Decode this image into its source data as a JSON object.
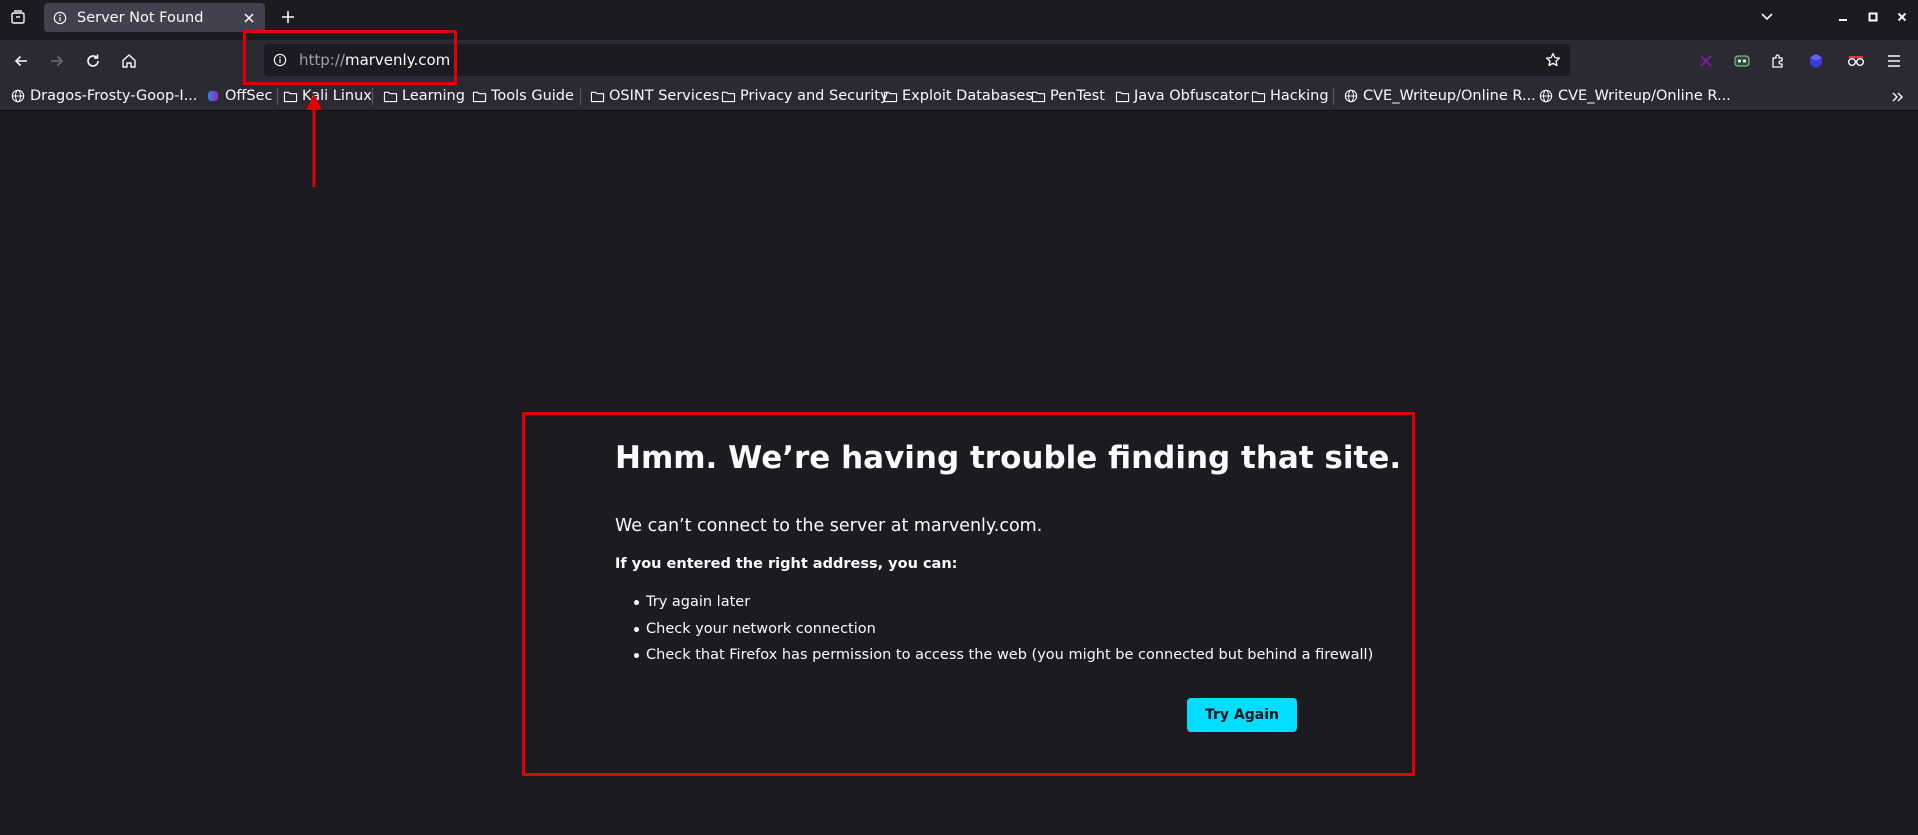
{
  "tab": {
    "title": "Server Not Found",
    "icon": "info-icon"
  },
  "urlbar": {
    "scheme": "http://",
    "host": "marvenly.com"
  },
  "bookmarks": [
    {
      "label": "Dragos-Frosty-Goop-I...",
      "icon": "globe-icon"
    },
    {
      "label": "OffSec",
      "icon": "offsec-icon"
    },
    {
      "label": "Kali Linux",
      "icon": "folder-icon"
    },
    {
      "label": "Learning",
      "icon": "folder-icon"
    },
    {
      "label": "Tools Guide",
      "icon": "folder-icon"
    },
    {
      "label": "OSINT Services",
      "icon": "folder-icon"
    },
    {
      "label": "Privacy and Security",
      "icon": "folder-icon"
    },
    {
      "label": "Exploit Databases",
      "icon": "folder-icon"
    },
    {
      "label": "PenTest",
      "icon": "folder-icon"
    },
    {
      "label": "Java Obfuscator",
      "icon": "folder-icon"
    },
    {
      "label": "Hacking",
      "icon": "folder-icon"
    },
    {
      "label": "CVE_Writeup/Online R...",
      "icon": "globe-icon"
    },
    {
      "label": "CVE_Writeup/Online R...",
      "icon": "globe-icon"
    }
  ],
  "error": {
    "title": "Hmm. We’re having trouble finding that site.",
    "description": "We can’t connect to the server at marvenly.com.",
    "subtitle": "If you entered the right address, you can:",
    "suggestions": [
      "Try again later",
      "Check your network connection",
      "Check that Firefox has permission to access the web (you might be connected but behind a firewall)"
    ],
    "button_label": "Try Again"
  },
  "colors": {
    "accent": "#00ddff",
    "annotation": "#e00000",
    "page_bg": "#1c1b22",
    "toolbar_bg": "#2b2a33"
  }
}
